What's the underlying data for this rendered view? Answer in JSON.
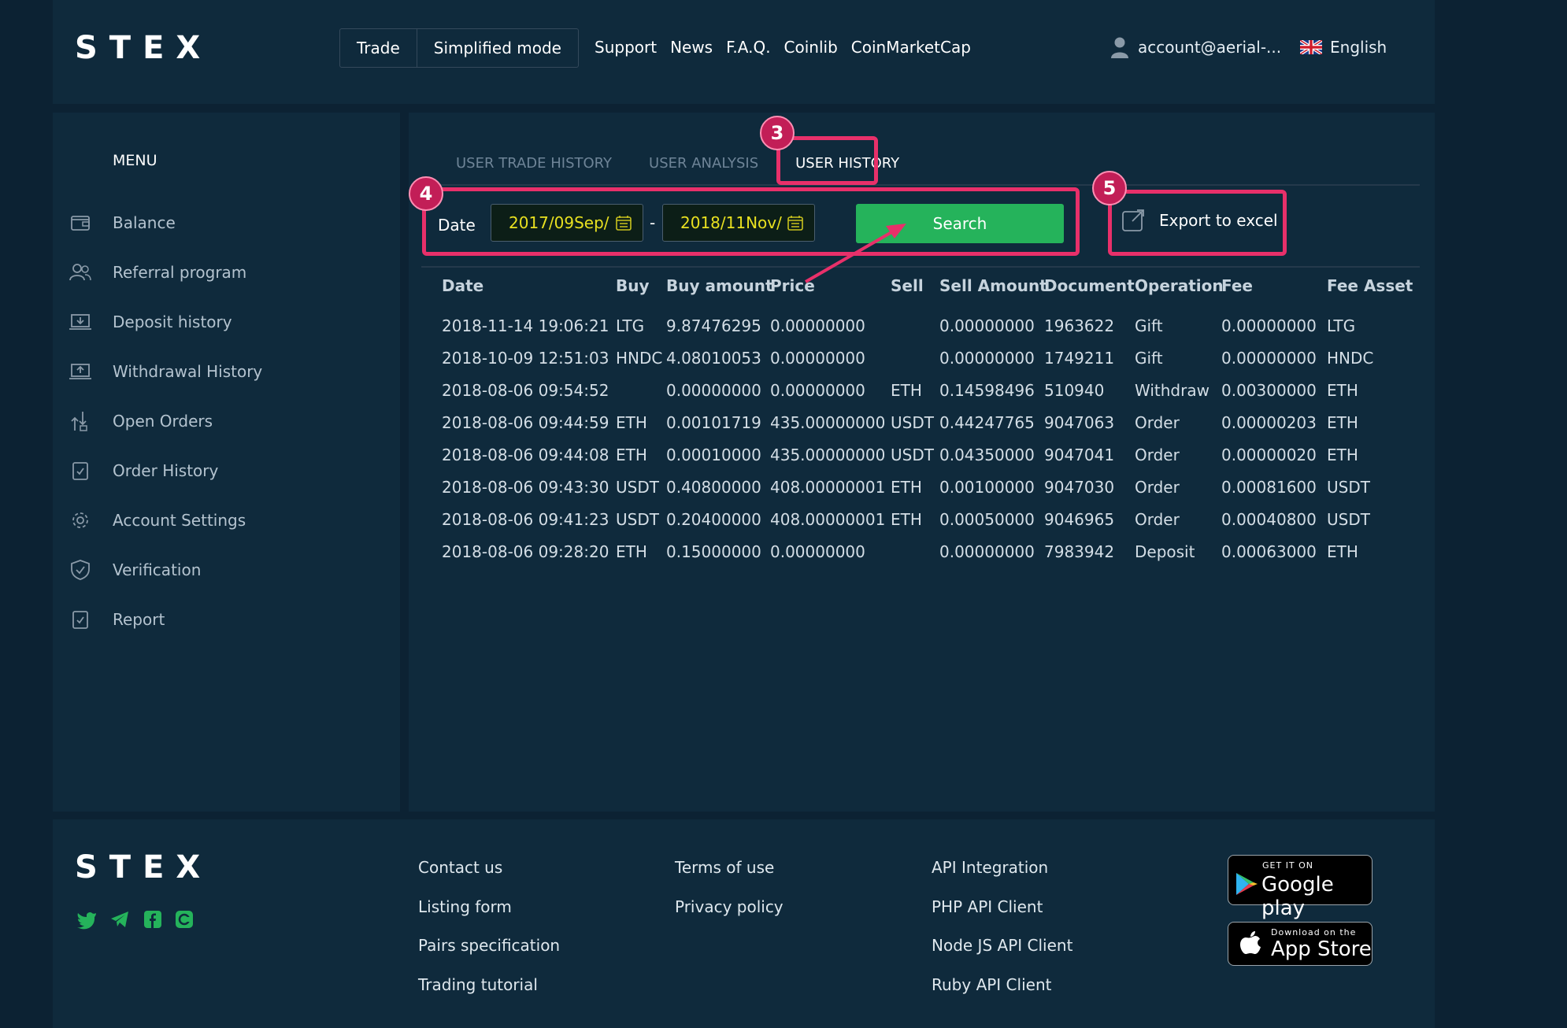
{
  "header": {
    "logo": "STEX",
    "mode_buttons": [
      "Trade",
      "Simplified mode"
    ],
    "nav": [
      "Support",
      "News",
      "F.A.Q.",
      "Coinlib",
      "CoinMarketCap"
    ],
    "account": "account@aerial-...",
    "language": "English"
  },
  "sidebar": {
    "title": "MENU",
    "items": [
      {
        "label": "Balance",
        "icon": "wallet-icon"
      },
      {
        "label": "Referral program",
        "icon": "users-icon"
      },
      {
        "label": "Deposit history",
        "icon": "deposit-icon"
      },
      {
        "label": "Withdrawal History",
        "icon": "withdraw-icon"
      },
      {
        "label": "Open Orders",
        "icon": "open-orders-icon"
      },
      {
        "label": "Order History",
        "icon": "order-history-icon"
      },
      {
        "label": "Account Settings",
        "icon": "gear-icon"
      },
      {
        "label": "Verification",
        "icon": "shield-icon"
      },
      {
        "label": "Report",
        "icon": "report-icon"
      }
    ]
  },
  "main": {
    "tabs": [
      "USER TRADE HISTORY",
      "USER ANALYSIS",
      "USER HISTORY"
    ],
    "active_tab": "USER HISTORY",
    "filter": {
      "date_label": "Date",
      "from": "2017/09Sep/",
      "separator": "-",
      "to": "2018/11Nov/",
      "search_label": "Search",
      "export_label": "Export to excel"
    },
    "columns": [
      "Date",
      "Buy",
      "Buy amount",
      "Price",
      "Sell",
      "Sell Amount",
      "Document",
      "Operation",
      "Fee",
      "Fee Asset"
    ],
    "rows": [
      [
        "2018-11-14 19:06:21",
        "LTG",
        "9.87476295",
        "0.00000000",
        "",
        "0.00000000",
        "1963622",
        "Gift",
        "0.00000000",
        "LTG"
      ],
      [
        "2018-10-09 12:51:03",
        "HNDC",
        "4.08010053",
        "0.00000000",
        "",
        "0.00000000",
        "1749211",
        "Gift",
        "0.00000000",
        "HNDC"
      ],
      [
        "2018-08-06 09:54:52",
        "",
        "0.00000000",
        "0.00000000",
        "ETH",
        "0.14598496",
        "510940",
        "Withdraw",
        "0.00300000",
        "ETH"
      ],
      [
        "2018-08-06 09:44:59",
        "ETH",
        "0.00101719",
        "435.00000000",
        "USDT",
        "0.44247765",
        "9047063",
        "Order",
        "0.00000203",
        "ETH"
      ],
      [
        "2018-08-06 09:44:08",
        "ETH",
        "0.00010000",
        "435.00000000",
        "USDT",
        "0.04350000",
        "9047041",
        "Order",
        "0.00000020",
        "ETH"
      ],
      [
        "2018-08-06 09:43:30",
        "USDT",
        "0.40800000",
        "408.00000001",
        "ETH",
        "0.00100000",
        "9047030",
        "Order",
        "0.00081600",
        "USDT"
      ],
      [
        "2018-08-06 09:41:23",
        "USDT",
        "0.20400000",
        "408.00000001",
        "ETH",
        "0.00050000",
        "9046965",
        "Order",
        "0.00040800",
        "USDT"
      ],
      [
        "2018-08-06 09:28:20",
        "ETH",
        "0.15000000",
        "0.00000000",
        "",
        "0.00000000",
        "7983942",
        "Deposit",
        "0.00063000",
        "ETH"
      ]
    ]
  },
  "annotations": [
    "3",
    "4",
    "5"
  ],
  "footer": {
    "logo": "STEX",
    "col1": [
      "Contact us",
      "Listing form",
      "Pairs specification",
      "Trading tutorial"
    ],
    "col2": [
      "Terms of use",
      "Privacy policy"
    ],
    "col3": [
      "API Integration",
      "PHP API Client",
      "Node JS API Client",
      "Ruby API Client"
    ],
    "social": [
      "twitter-icon",
      "telegram-icon",
      "facebook-icon",
      "coinmarketcap-icon"
    ],
    "google_play": {
      "small": "GET IT ON",
      "big": "Google play"
    },
    "app_store": {
      "small": "Download on the",
      "big": "App Store"
    }
  },
  "colors": {
    "background": "#0c2233",
    "panel": "#0f2a3c",
    "accent_green": "#25b35b",
    "highlight": "#e8306a",
    "date_text": "#e8e020"
  }
}
